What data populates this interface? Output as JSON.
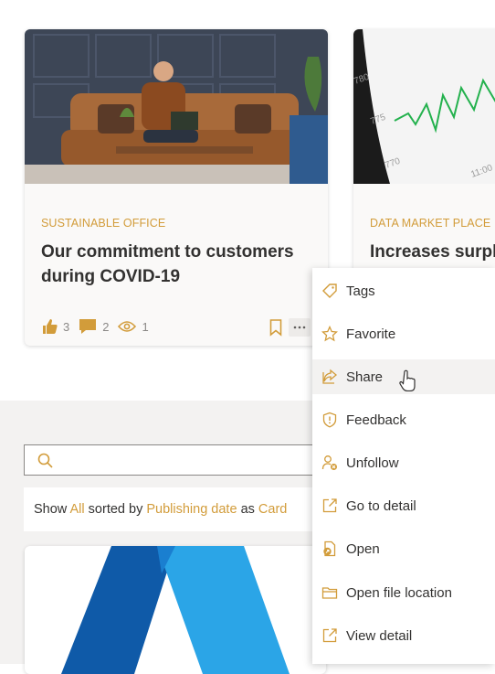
{
  "cards": [
    {
      "category": "SUSTAINABLE OFFICE",
      "title_line1": "Our commitment to customers",
      "title_line2": "during COVID-19",
      "likes": "3",
      "comments": "2",
      "views": "1"
    },
    {
      "category": "DATA MARKET PLACE",
      "title": "Increases surplus",
      "chart_ticks": [
        "780",
        "775",
        "770",
        "11:00"
      ]
    }
  ],
  "search": {
    "placeholder": ""
  },
  "showbar": {
    "show": "Show",
    "all": "All",
    "sorted_by": "sorted by",
    "field": "Publishing date",
    "as": "as",
    "view": "Card"
  },
  "menu": [
    {
      "label": "Tags",
      "icon": "tag-icon"
    },
    {
      "label": "Favorite",
      "icon": "star-icon"
    },
    {
      "label": "Share",
      "icon": "share-icon"
    },
    {
      "label": "Feedback",
      "icon": "shield-icon"
    },
    {
      "label": "Unfollow",
      "icon": "unfollow-icon"
    },
    {
      "label": "Go to detail",
      "icon": "open-external-icon"
    },
    {
      "label": "Open",
      "icon": "open-file-icon"
    },
    {
      "label": "Open file location",
      "icon": "folder-icon"
    },
    {
      "label": "View detail",
      "icon": "open-external-icon"
    }
  ],
  "colors": {
    "accent": "#d29c3a",
    "text": "#323130",
    "muted": "#8a8886"
  }
}
